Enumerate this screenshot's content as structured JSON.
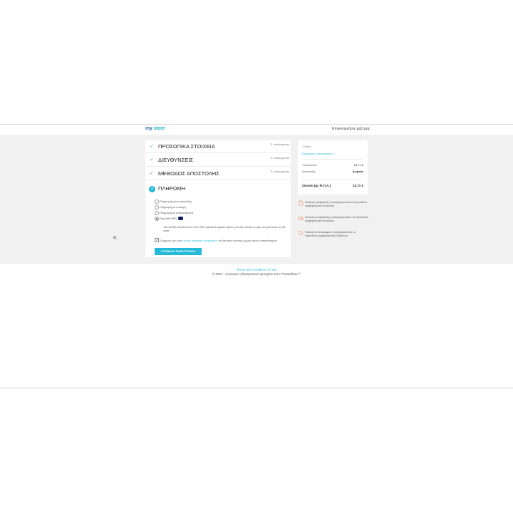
{
  "header": {
    "logo_part1": "my",
    "logo_part2": " ",
    "logo_part3": "store",
    "contact": "Επικοινωνήστε μαζί μας"
  },
  "checkout": {
    "steps": [
      {
        "title": "ΠΡΟΣΩΠΙΚΑ ΣΤΟΙΧΕΙΑ",
        "edit": "✎ επεξεργασία"
      },
      {
        "title": "ΔΙΕΥΘΥΝΣΕΙΣ",
        "edit": "✎ επεξεργασία"
      },
      {
        "title": "ΜΕΘΟΔΟΣ ΑΠΟΣΤΟΛΗΣ",
        "edit": "✎ επεξεργασία"
      }
    ],
    "payment": {
      "number": "4",
      "title": "ΠΛΗΡΩΜΗ",
      "options": [
        {
          "label": "Πληρωμή μέσω τραπέζης",
          "selected": false
        },
        {
          "label": "Πληρωμή με επιταγή",
          "selected": false
        },
        {
          "label": "Πληρωμή με Αντικαταβολή",
          "selected": false
        },
        {
          "label": "Pay with IRIS",
          "selected": true
        }
      ],
      "description": "You will be transferred to JCC IRIS payment system where you will choose to pay via your bank or QR code.",
      "tos_prefix": "Συμφωνώ με τους",
      "tos_link": "όρους παροχής υπηρεσιών",
      "tos_suffix": "και θα τηρώ αυτούς χωρίς όρους αποκλεισμού.",
      "tos_checked": true,
      "order_button": "ΥΠΟΒΟΛΗ ΠΑΡΑΓΓΕΛΙΑΣ"
    }
  },
  "summary": {
    "items": "1 είδος",
    "show_details": "Εμφάνιση λεπτομερειών ⌄",
    "subtotal_label": "Υποσύνολο",
    "subtotal_value": "23,71 €",
    "shipping_label": "Αποστολή",
    "shipping_value": "Δωρεάν",
    "total_label": "Σύνολο (με Φ.Π.Α.)",
    "total_value": "23,71 €"
  },
  "reassurance": [
    {
      "text": "Πολιτική ασφαλείας (επεξεργαστείτε το Πρόσθετο Διαβεβαίωση Πελατών)",
      "icon": "security-icon"
    },
    {
      "text": "Πολιτική παράδοσης (επεξεργαστείτε το Πρόσθετο Διαβεβαίωση Πελατών)",
      "icon": "delivery-icon"
    },
    {
      "text": "Πολιτική επιστροφών (επεξεργαστείτε το Πρόσθετο Διαβεβαίωση Πελατών)",
      "icon": "return-icon"
    }
  ],
  "footer": {
    "link": "Terms and conditions of use",
    "copyright": "© 2024 - Λογισμικό ηλεκτρονικού εμπορίου από PrestaShop™"
  },
  "colors": {
    "accent": "#24b9d7",
    "check": "#4cbb6c",
    "background": "#f1f1f1"
  }
}
